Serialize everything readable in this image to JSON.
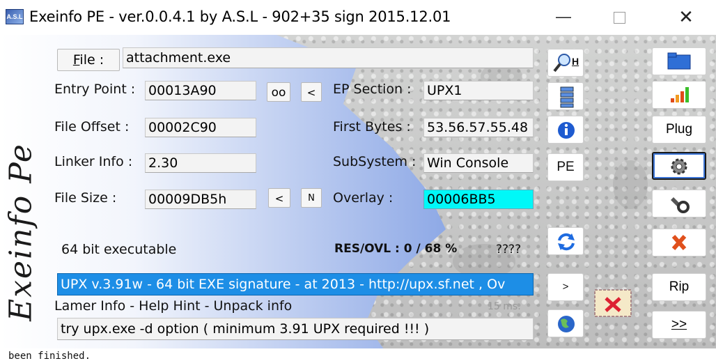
{
  "window": {
    "title": "Exeinfo PE - ver.0.0.4.1  by A.S.L -  902+35 sign  2015.12.01",
    "icon_text": "A.S.L",
    "min_glyph": "—",
    "close_glyph": "✕"
  },
  "logo_text": "Exeinfo Pe",
  "file": {
    "label_prefix": "F",
    "label_rest": "ile :",
    "value": "attachment.exe"
  },
  "fields": {
    "entry_point": {
      "label": "Entry Point :",
      "value": "00013A90"
    },
    "file_offset": {
      "label": "File Offset :",
      "value": "00002C90"
    },
    "linker_info": {
      "label": "Linker Info :",
      "value": "2.30"
    },
    "file_size": {
      "label": "File Size :",
      "value": "00009DB5h"
    },
    "ep_section": {
      "label": "EP Section :",
      "value": "UPX1"
    },
    "first_bytes": {
      "label": "First Bytes :",
      "value": "53.56.57.55.48"
    },
    "subsystem": {
      "label": "SubSystem :",
      "value": "Win Console"
    },
    "overlay": {
      "label": "Overlay :",
      "value": "00006BB5"
    }
  },
  "small_buttons": {
    "oo": "oo",
    "lt_entry": "<",
    "lt_size": "<",
    "n_size": "N"
  },
  "status": {
    "bitness": "64 bit executable",
    "res_ovl": "RES/OVL : 0 / 68 %",
    "unknown": "????"
  },
  "detection": "UPX v.3.91w - 64 bit EXE signature  - at  2013 - http://upx.sf.net , Ov",
  "lamer_info_label": "Lamer Info - Help Hint - Unpack info",
  "hint": "try upx.exe -d option ( minimum 3.91 UPX required !!! )",
  "timer": "15 ms.",
  "tool_buttons": {
    "h_label": "H",
    "pe_label": "PE",
    "next_label": ">"
  },
  "right_buttons": {
    "plug": "Plug",
    "rip": "Rip",
    "more": ">>"
  },
  "console_text": "been finished.",
  "colors": {
    "overlay_highlight": "#00f8f8",
    "selection": "#1d8ee6"
  }
}
